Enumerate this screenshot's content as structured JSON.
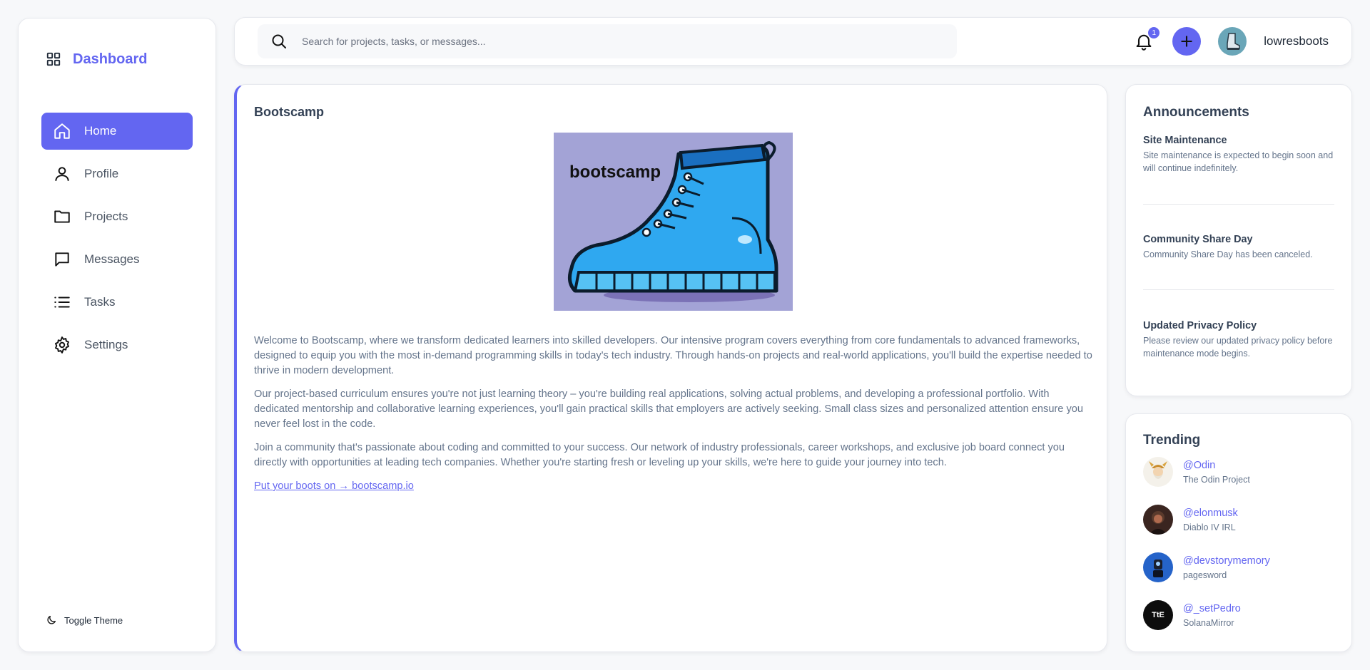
{
  "sidebar": {
    "brand": "Dashboard",
    "items": [
      {
        "label": "Home",
        "icon": "home-icon",
        "active": true
      },
      {
        "label": "Profile",
        "icon": "user-icon",
        "active": false
      },
      {
        "label": "Projects",
        "icon": "folder-icon",
        "active": false
      },
      {
        "label": "Messages",
        "icon": "message-icon",
        "active": false
      },
      {
        "label": "Tasks",
        "icon": "list-icon",
        "active": false
      },
      {
        "label": "Settings",
        "icon": "gear-icon",
        "active": false
      }
    ],
    "toggle_theme": "Toggle Theme"
  },
  "topbar": {
    "search_placeholder": "Search for projects, tasks, or messages...",
    "notification_count": "1",
    "username": "lowresboots"
  },
  "main": {
    "title": "Bootscamp",
    "hero_text": "bootscamp",
    "paragraphs": [
      "Welcome to Bootscamp, where we transform dedicated learners into skilled developers. Our intensive program covers everything from core fundamentals to advanced frameworks, designed to equip you with the most in-demand programming skills in today's tech industry. Through hands-on projects and real-world applications, you'll build the expertise needed to thrive in modern development.",
      "Our project-based curriculum ensures you're not just learning theory – you're building real applications, solving actual problems, and developing a professional portfolio. With dedicated mentorship and collaborative learning experiences, you'll gain practical skills that employers are actively seeking. Small class sizes and personalized attention ensure you never feel lost in the code.",
      "Join a community that's passionate about coding and committed to your success. Our network of industry professionals, career workshops, and exclusive job board connect you directly with opportunities at leading tech companies. Whether you're starting fresh or leveling up your skills, we're here to guide your journey into tech."
    ],
    "cta": "Put your boots on → bootscamp.io"
  },
  "announcements": {
    "title": "Announcements",
    "items": [
      {
        "title": "Site Maintenance",
        "body": "Site maintenance is expected to begin soon and will continue indefinitely."
      },
      {
        "title": "Community Share Day",
        "body": "Community Share Day has been canceled."
      },
      {
        "title": "Updated Privacy Policy",
        "body": "Please review our updated privacy policy before maintenance mode begins."
      }
    ]
  },
  "trending": {
    "title": "Trending",
    "items": [
      {
        "handle": "@Odin",
        "subtitle": "The Odin Project"
      },
      {
        "handle": "@elonmusk",
        "subtitle": "Diablo IV IRL"
      },
      {
        "handle": "@devstorymemory",
        "subtitle": "pagesword"
      },
      {
        "handle": "@_setPedro",
        "subtitle": "SolanaMirror",
        "avatar_text": "TtE"
      }
    ]
  },
  "colors": {
    "accent": "#6366f1",
    "background": "#f7f8fa",
    "text_muted": "#64748b",
    "hero_bg": "#a3a3d6"
  }
}
